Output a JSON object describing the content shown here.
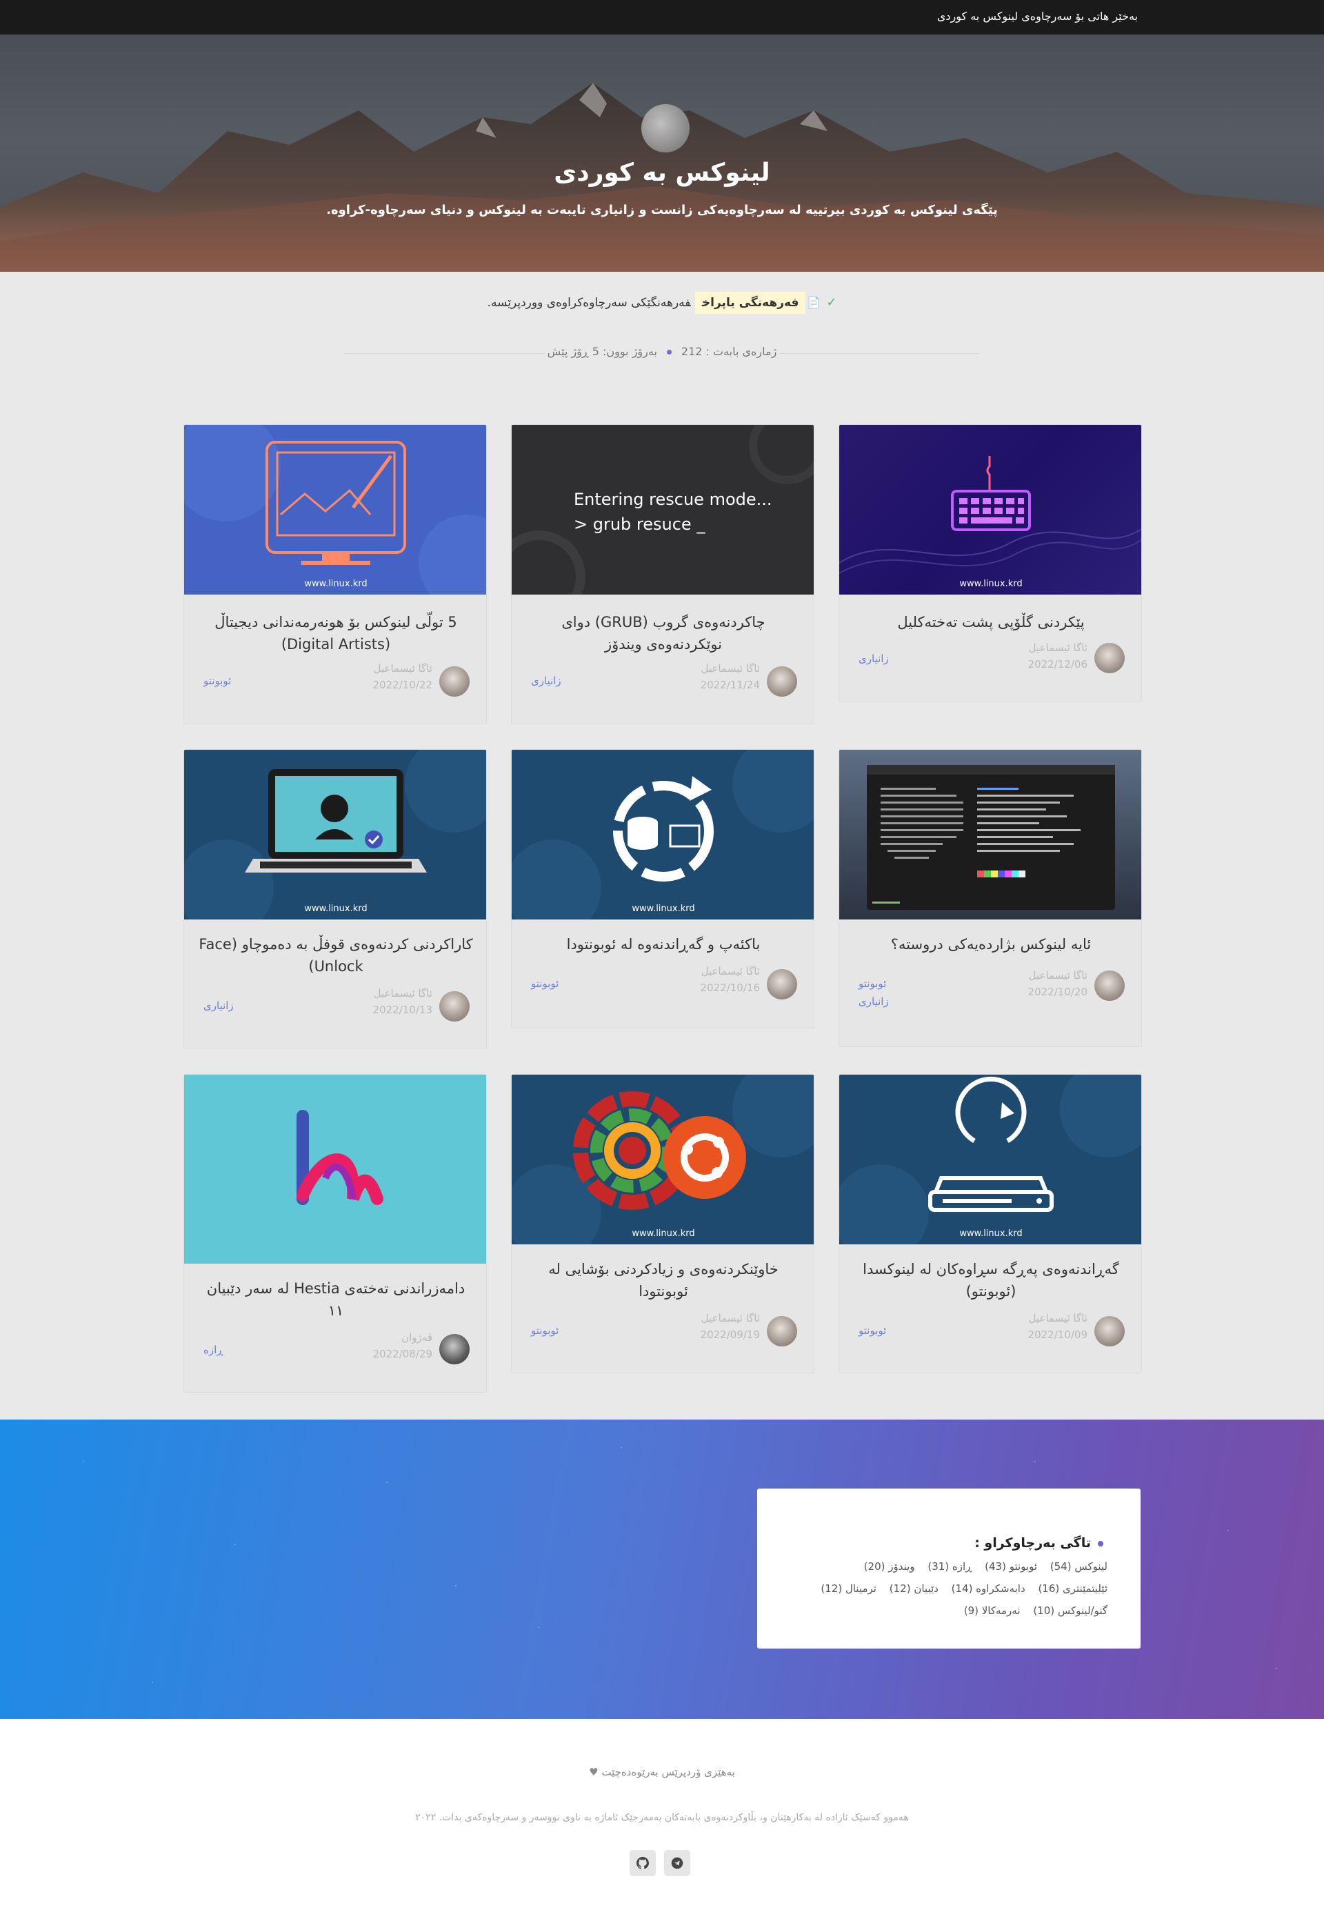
{
  "topbar": {
    "welcome": "بەخێر هاتی بۆ سەرچاوەی لینوکس بە کوردی"
  },
  "hero": {
    "title": "لینوکس بە کوردی",
    "subtitle": "پێگەی لینوکس بە کوردی بیرتییە لە سەرچاوەیەکی زانست و زانیاری تایبەت بە لینوکس و دنیای سەرچاوە-کراوە."
  },
  "notice": {
    "highlight": "فەرهەنگی یاپراخ",
    "text": "فەرهەنگێکی سەرچاوەکراوەی ووردپرێسە."
  },
  "meta": {
    "count": "ژمارەی بابەت : 212",
    "updated": "بەرۆژ بوون: 5 ڕۆژ پێش"
  },
  "posts": [
    {
      "title": "پێکردنی گڵۆپی پشت تەختەکلیل",
      "author": "ئاگا ئیسماعیل",
      "date": "2022/12/06",
      "categories": [
        "زانیاری"
      ],
      "watermark": "www.linux.krd"
    },
    {
      "title": "چاکردنەوەی گروب (GRUB) دوای نوێکردنەوەی ویندۆز",
      "author": "ئاگا ئیسماعیل",
      "date": "2022/11/24",
      "categories": [
        "زانیاری"
      ],
      "image_text": [
        "Entering rescue mode...",
        "> grub resuce _"
      ]
    },
    {
      "title": "5 تولّی لینوکس بۆ هونەرمەندانی دیجیتاڵ (Digital Artists)",
      "author": "ئاگا ئیسماعیل",
      "date": "2022/10/22",
      "categories": [
        "ئوبونتو"
      ],
      "watermark": "www.linux.krd"
    },
    {
      "title": "ئایە لینوکس بژاردەیەکی دروستە؟",
      "author": "ئاگا ئیسماعیل",
      "date": "2022/10/20",
      "categories": [
        "ئوبونتو",
        "زانیاری"
      ]
    },
    {
      "title": "باکئەپ و گەڕاندنەوە لە ئوبونتودا",
      "author": "ئاگا ئیسماعیل",
      "date": "2022/10/16",
      "categories": [
        "ئوبونتو"
      ],
      "watermark": "www.linux.krd"
    },
    {
      "title": "کاراکردنی کردنەوەی قوفڵ بە دەموچاو (Face Unlock)",
      "author": "ئاگا ئیسماعیل",
      "date": "2022/10/13",
      "categories": [
        "زانیاری"
      ],
      "watermark": "www.linux.krd"
    },
    {
      "title": "گەڕاندنەوەی پەڕگە سڕاوەکان لە لینوکسدا (ئوبونتو)",
      "author": "ئاگا ئیسماعیل",
      "date": "2022/10/09",
      "categories": [
        "ئوبونتو"
      ],
      "watermark": "www.linux.krd"
    },
    {
      "title": "خاوێنکردنەوەی و زیادکردنی بۆشایی لە ئوبونتودا",
      "author": "ئاگا ئیسماعیل",
      "date": "2022/09/19",
      "categories": [
        "ئوبونتو"
      ],
      "watermark": "www.linux.krd"
    },
    {
      "title": "دامەزراندنی تەختەی Hestia لە سەر دێبیان ١١",
      "author": "ڤەژوان",
      "date": "2022/08/29",
      "categories": [
        "ڕازە"
      ]
    }
  ],
  "tags_widget": {
    "title": "تاگی بەرچاوکراو :",
    "rows": [
      [
        "لینوکس (54)",
        "ئوبونتو (43)",
        "ڕازە (31)",
        "ویندۆز (20)"
      ],
      [
        "ئێلیتمێنتری (16)",
        "دابەشکراوە (14)",
        "دێبیان (12)",
        "ترمینال (12)"
      ],
      [
        "گنو/لینوکس (10)",
        "نەرمەکالا (9)"
      ]
    ]
  },
  "footer": {
    "powered": "بەهێزی ۆردپرێس بەرێوەدەچێت",
    "rights": "هەموو کەسێک ئازادە لە بەکارهێنان و، بڵاوکردنەوەی بابەتەکان بەمەرجێک ئاماژە بە ناوی نووسەر و سەرچاوەکەی بدات. ٢٠٢٢",
    "social": [
      "github-icon",
      "telegram-icon"
    ]
  }
}
